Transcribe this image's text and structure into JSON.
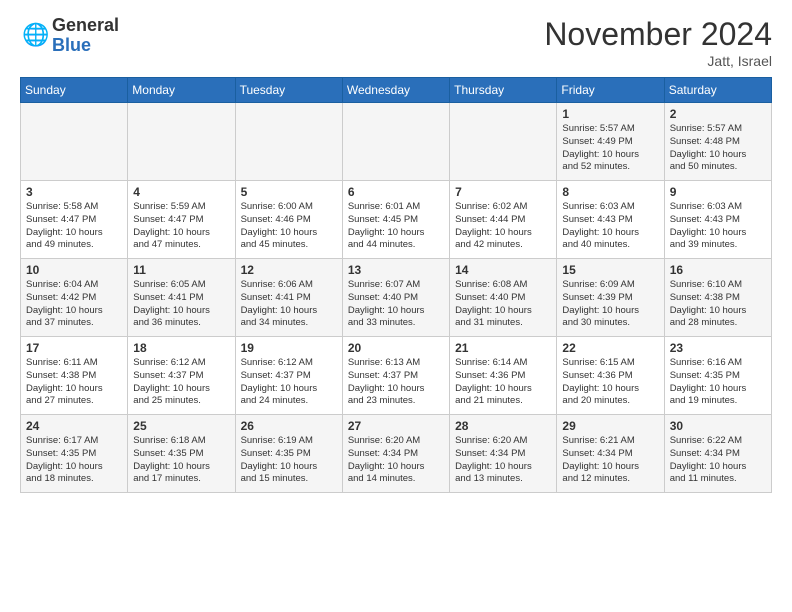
{
  "header": {
    "logo_general": "General",
    "logo_blue": "Blue",
    "month": "November 2024",
    "location": "Jatt, Israel"
  },
  "days_of_week": [
    "Sunday",
    "Monday",
    "Tuesday",
    "Wednesday",
    "Thursday",
    "Friday",
    "Saturday"
  ],
  "weeks": [
    [
      {
        "day": "",
        "info": ""
      },
      {
        "day": "",
        "info": ""
      },
      {
        "day": "",
        "info": ""
      },
      {
        "day": "",
        "info": ""
      },
      {
        "day": "",
        "info": ""
      },
      {
        "day": "1",
        "info": "Sunrise: 5:57 AM\nSunset: 4:49 PM\nDaylight: 10 hours\nand 52 minutes."
      },
      {
        "day": "2",
        "info": "Sunrise: 5:57 AM\nSunset: 4:48 PM\nDaylight: 10 hours\nand 50 minutes."
      }
    ],
    [
      {
        "day": "3",
        "info": "Sunrise: 5:58 AM\nSunset: 4:47 PM\nDaylight: 10 hours\nand 49 minutes."
      },
      {
        "day": "4",
        "info": "Sunrise: 5:59 AM\nSunset: 4:47 PM\nDaylight: 10 hours\nand 47 minutes."
      },
      {
        "day": "5",
        "info": "Sunrise: 6:00 AM\nSunset: 4:46 PM\nDaylight: 10 hours\nand 45 minutes."
      },
      {
        "day": "6",
        "info": "Sunrise: 6:01 AM\nSunset: 4:45 PM\nDaylight: 10 hours\nand 44 minutes."
      },
      {
        "day": "7",
        "info": "Sunrise: 6:02 AM\nSunset: 4:44 PM\nDaylight: 10 hours\nand 42 minutes."
      },
      {
        "day": "8",
        "info": "Sunrise: 6:03 AM\nSunset: 4:43 PM\nDaylight: 10 hours\nand 40 minutes."
      },
      {
        "day": "9",
        "info": "Sunrise: 6:03 AM\nSunset: 4:43 PM\nDaylight: 10 hours\nand 39 minutes."
      }
    ],
    [
      {
        "day": "10",
        "info": "Sunrise: 6:04 AM\nSunset: 4:42 PM\nDaylight: 10 hours\nand 37 minutes."
      },
      {
        "day": "11",
        "info": "Sunrise: 6:05 AM\nSunset: 4:41 PM\nDaylight: 10 hours\nand 36 minutes."
      },
      {
        "day": "12",
        "info": "Sunrise: 6:06 AM\nSunset: 4:41 PM\nDaylight: 10 hours\nand 34 minutes."
      },
      {
        "day": "13",
        "info": "Sunrise: 6:07 AM\nSunset: 4:40 PM\nDaylight: 10 hours\nand 33 minutes."
      },
      {
        "day": "14",
        "info": "Sunrise: 6:08 AM\nSunset: 4:40 PM\nDaylight: 10 hours\nand 31 minutes."
      },
      {
        "day": "15",
        "info": "Sunrise: 6:09 AM\nSunset: 4:39 PM\nDaylight: 10 hours\nand 30 minutes."
      },
      {
        "day": "16",
        "info": "Sunrise: 6:10 AM\nSunset: 4:38 PM\nDaylight: 10 hours\nand 28 minutes."
      }
    ],
    [
      {
        "day": "17",
        "info": "Sunrise: 6:11 AM\nSunset: 4:38 PM\nDaylight: 10 hours\nand 27 minutes."
      },
      {
        "day": "18",
        "info": "Sunrise: 6:12 AM\nSunset: 4:37 PM\nDaylight: 10 hours\nand 25 minutes."
      },
      {
        "day": "19",
        "info": "Sunrise: 6:12 AM\nSunset: 4:37 PM\nDaylight: 10 hours\nand 24 minutes."
      },
      {
        "day": "20",
        "info": "Sunrise: 6:13 AM\nSunset: 4:37 PM\nDaylight: 10 hours\nand 23 minutes."
      },
      {
        "day": "21",
        "info": "Sunrise: 6:14 AM\nSunset: 4:36 PM\nDaylight: 10 hours\nand 21 minutes."
      },
      {
        "day": "22",
        "info": "Sunrise: 6:15 AM\nSunset: 4:36 PM\nDaylight: 10 hours\nand 20 minutes."
      },
      {
        "day": "23",
        "info": "Sunrise: 6:16 AM\nSunset: 4:35 PM\nDaylight: 10 hours\nand 19 minutes."
      }
    ],
    [
      {
        "day": "24",
        "info": "Sunrise: 6:17 AM\nSunset: 4:35 PM\nDaylight: 10 hours\nand 18 minutes."
      },
      {
        "day": "25",
        "info": "Sunrise: 6:18 AM\nSunset: 4:35 PM\nDaylight: 10 hours\nand 17 minutes."
      },
      {
        "day": "26",
        "info": "Sunrise: 6:19 AM\nSunset: 4:35 PM\nDaylight: 10 hours\nand 15 minutes."
      },
      {
        "day": "27",
        "info": "Sunrise: 6:20 AM\nSunset: 4:34 PM\nDaylight: 10 hours\nand 14 minutes."
      },
      {
        "day": "28",
        "info": "Sunrise: 6:20 AM\nSunset: 4:34 PM\nDaylight: 10 hours\nand 13 minutes."
      },
      {
        "day": "29",
        "info": "Sunrise: 6:21 AM\nSunset: 4:34 PM\nDaylight: 10 hours\nand 12 minutes."
      },
      {
        "day": "30",
        "info": "Sunrise: 6:22 AM\nSunset: 4:34 PM\nDaylight: 10 hours\nand 11 minutes."
      }
    ]
  ]
}
